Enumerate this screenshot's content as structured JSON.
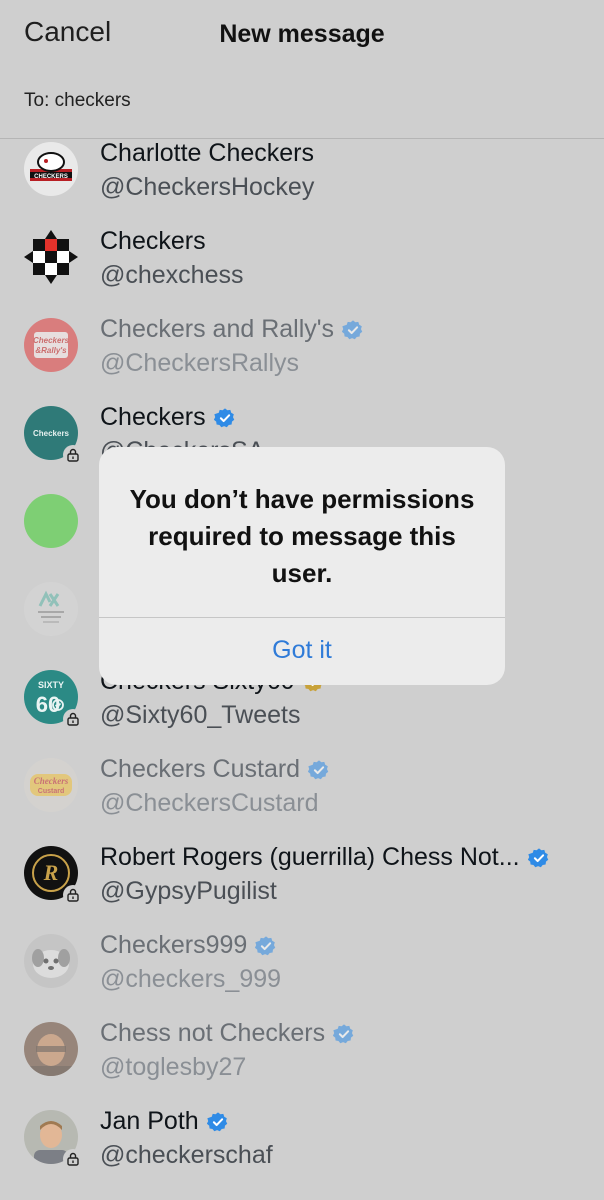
{
  "header": {
    "cancel_label": "Cancel",
    "title": "New message",
    "to_prefix": "To:",
    "to_value": "checkers"
  },
  "colors": {
    "background": "#cfcfcf",
    "verified_badge": "#2f8be6",
    "dialog_button": "#2f7bd8"
  },
  "results": [
    {
      "name": "Charlotte Checkers",
      "handle": "@CheckersHockey",
      "verified": false,
      "locked": false,
      "dimmed": false,
      "avatar_icon": "charlotte-checkers-logo"
    },
    {
      "name": "Checkers",
      "handle": "@chexchess",
      "verified": false,
      "locked": false,
      "dimmed": false,
      "avatar_icon": "checkerboard-logo"
    },
    {
      "name": "Checkers and Rally's",
      "handle": "@CheckersRallys",
      "verified": true,
      "locked": false,
      "dimmed": true,
      "avatar_icon": "checkers-rallys-logo",
      "avatar_text": "Checkers & Rally's"
    },
    {
      "name": "Checkers",
      "handle": "@CheckersSA",
      "verified": true,
      "locked": true,
      "dimmed": false,
      "avatar_icon": "checkers-sa-logo",
      "avatar_text": "Checkers"
    },
    {
      "name": "",
      "handle": "",
      "verified": false,
      "locked": false,
      "dimmed": false,
      "avatar_icon": "green-circle-avatar"
    },
    {
      "name": "",
      "handle": "",
      "verified": false,
      "locked": false,
      "dimmed": true,
      "avatar_icon": "ax-logo"
    },
    {
      "name": "Checkers Sixty60",
      "handle": "@Sixty60_Tweets",
      "verified": true,
      "locked": true,
      "dimmed": false,
      "avatar_icon": "sixty60-logo"
    },
    {
      "name": "Checkers Custard",
      "handle": "@CheckersCustard",
      "verified": true,
      "locked": false,
      "dimmed": true,
      "avatar_icon": "checkers-custard-logo",
      "avatar_text": "Checkers Custard"
    },
    {
      "name": "Robert Rogers (guerrilla) Chess Not...",
      "handle": "@GypsyPugilist",
      "verified": true,
      "locked": true,
      "dimmed": false,
      "avatar_icon": "r-monogram-logo",
      "avatar_text": "R"
    },
    {
      "name": "Checkers999",
      "handle": "@checkers_999",
      "verified": true,
      "locked": false,
      "dimmed": true,
      "avatar_icon": "dog-photo-avatar"
    },
    {
      "name": "Chess not Checkers",
      "handle": "@toglesby27",
      "verified": true,
      "locked": false,
      "dimmed": true,
      "avatar_icon": "person-photo-avatar"
    },
    {
      "name": "Jan Poth",
      "handle": "@checkerschaf",
      "verified": true,
      "locked": true,
      "dimmed": false,
      "avatar_icon": "person-photo-avatar"
    }
  ],
  "dialog": {
    "message": "You don’t have permissions required to message this user.",
    "button_label": "Got it"
  }
}
